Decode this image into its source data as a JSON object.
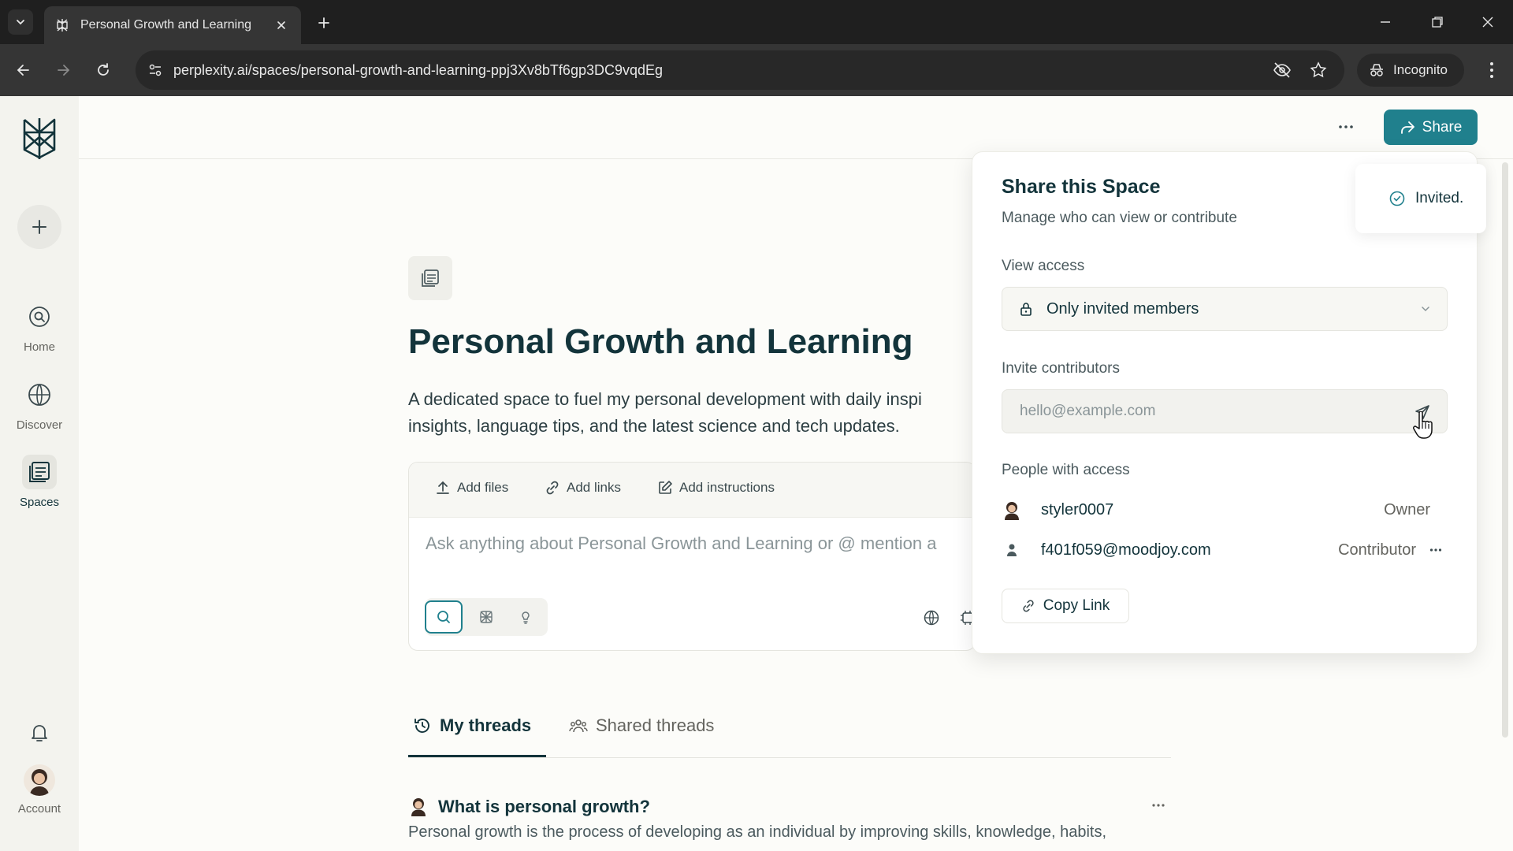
{
  "browser": {
    "tab_title": "Personal Growth and Learning",
    "url": "perplexity.ai/spaces/personal-growth-and-learning-ppj3Xv8bTf6gp3DC9vqdEg",
    "incognito_label": "Incognito"
  },
  "sidebar": {
    "items": [
      {
        "label": "Home",
        "icon": "search-circle-icon"
      },
      {
        "label": "Discover",
        "icon": "globe-icon"
      },
      {
        "label": "Spaces",
        "icon": "spaces-icon"
      }
    ],
    "account_label": "Account"
  },
  "header": {
    "share_label": "Share"
  },
  "space": {
    "title": "Personal Growth and Learning",
    "description": "A dedicated space to fuel my personal development with daily inspi insights, language tips, and the latest science and tech updates.",
    "actions": {
      "add_files": "Add files",
      "add_links": "Add links",
      "add_instructions": "Add instructions"
    },
    "ask_placeholder": "Ask anything about Personal Growth and Learning or @ mention a"
  },
  "threads": {
    "tabs": {
      "my": "My threads",
      "shared": "Shared threads"
    },
    "items": [
      {
        "title": "What is personal growth?",
        "snippet": "Personal growth is the process of developing as an individual by improving skills, knowledge, habits,"
      }
    ]
  },
  "share_popover": {
    "title": "Share this Space",
    "subtitle": "Manage who can view or contribute",
    "view_access_label": "View access",
    "view_access_value": "Only invited members",
    "invite_label": "Invite contributors",
    "invite_placeholder": "hello@example.com",
    "people_label": "People with access",
    "people": [
      {
        "name": "styler0007",
        "role": "Owner"
      },
      {
        "name": "f401f059@moodjoy.com",
        "role": "Contributor"
      }
    ],
    "copy_link_label": "Copy Link"
  },
  "toast": {
    "text": "Invited."
  },
  "colors": {
    "accent": "#20808d",
    "text_primary": "#13343b",
    "background": "#fcfcf9",
    "chrome_dark": "#1f1f1f"
  }
}
